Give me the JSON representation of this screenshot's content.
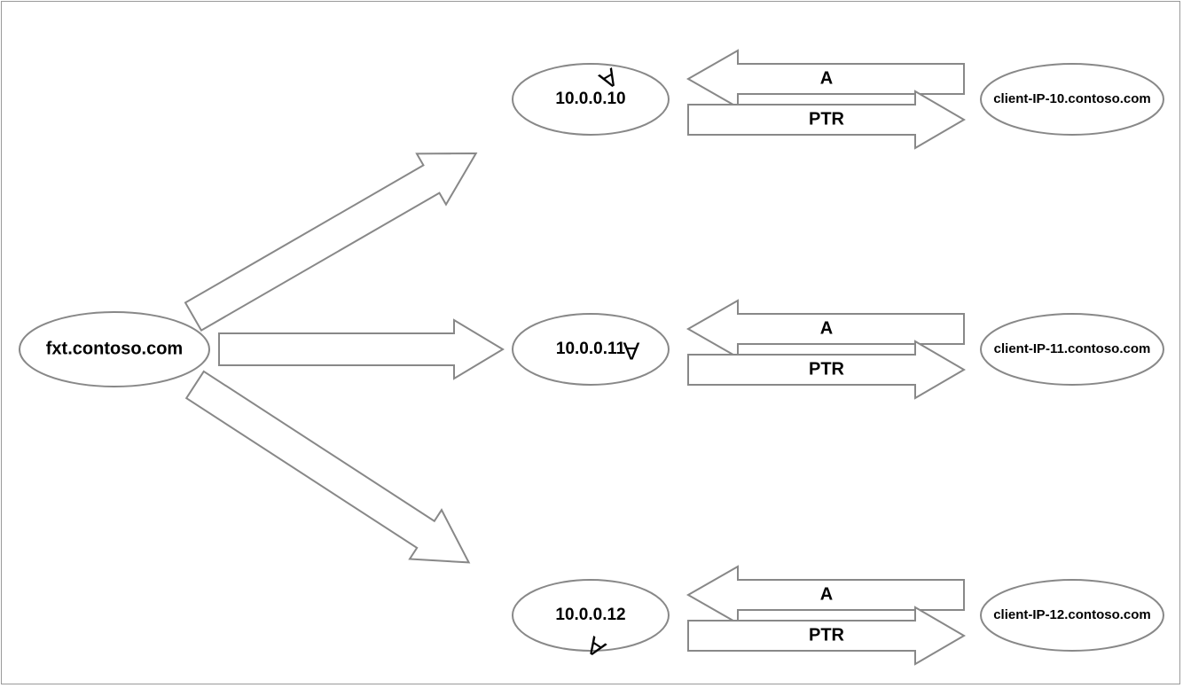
{
  "source": {
    "label": "fxt.contoso.com"
  },
  "ips": [
    {
      "label": "10.0.0.10"
    },
    {
      "label": "10.0.0.11"
    },
    {
      "label": "10.0.0.12"
    }
  ],
  "clients": [
    {
      "label": "client-IP-10.contoso.com"
    },
    {
      "label": "client-IP-11.contoso.com"
    },
    {
      "label": "client-IP-12.contoso.com"
    }
  ],
  "arrows": {
    "source_to_ip": "A",
    "client_to_ip": "A",
    "ip_to_client": "PTR"
  }
}
